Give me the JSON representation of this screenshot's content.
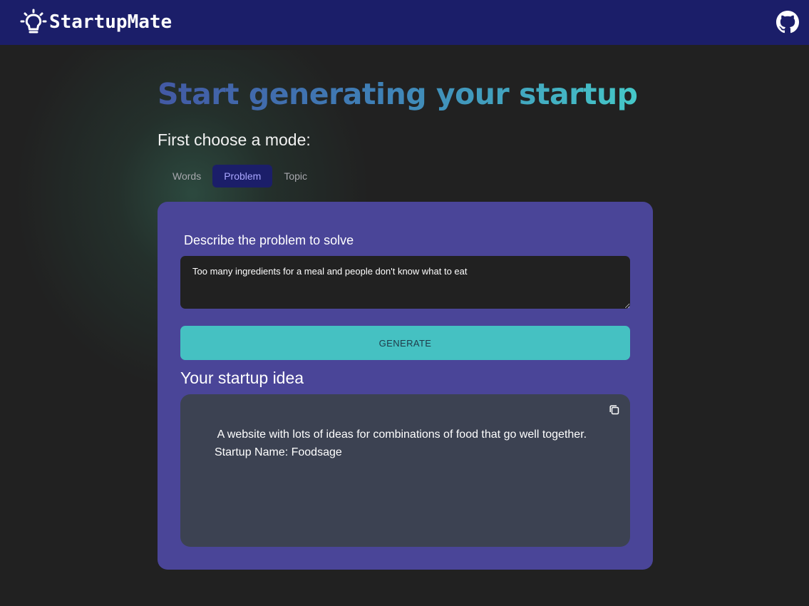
{
  "navbar": {
    "brand_name": "StartupMate",
    "logo_icon": "lightbulb-icon",
    "github_icon": "github-icon"
  },
  "hero": {
    "title": "Start generating your startup",
    "gradient_colors": [
      "#4359a4",
      "#3f7fb6",
      "#45c8c8"
    ]
  },
  "mode": {
    "heading": "First choose a mode:",
    "tabs": [
      {
        "label": "Words",
        "active": false
      },
      {
        "label": "Problem",
        "active": true
      },
      {
        "label": "Topic",
        "active": false
      }
    ]
  },
  "form": {
    "label": "Describe the problem to solve",
    "input_value": "Too many ingredients for a meal and people don't know what to eat",
    "generate_label": "GENERATE"
  },
  "result": {
    "heading": "Your startup idea",
    "line1": " A website with lots of ideas for combinations of food that go well together.",
    "line2": "Startup Name: Foodsage",
    "copy_icon": "copy-icon"
  },
  "colors": {
    "background": "#212121",
    "navbar": "#1b1e69",
    "card": "#4a4598",
    "button": "#45c1c2",
    "result_box": "#3c4252",
    "active_tab_text": "#a9a6ff"
  }
}
